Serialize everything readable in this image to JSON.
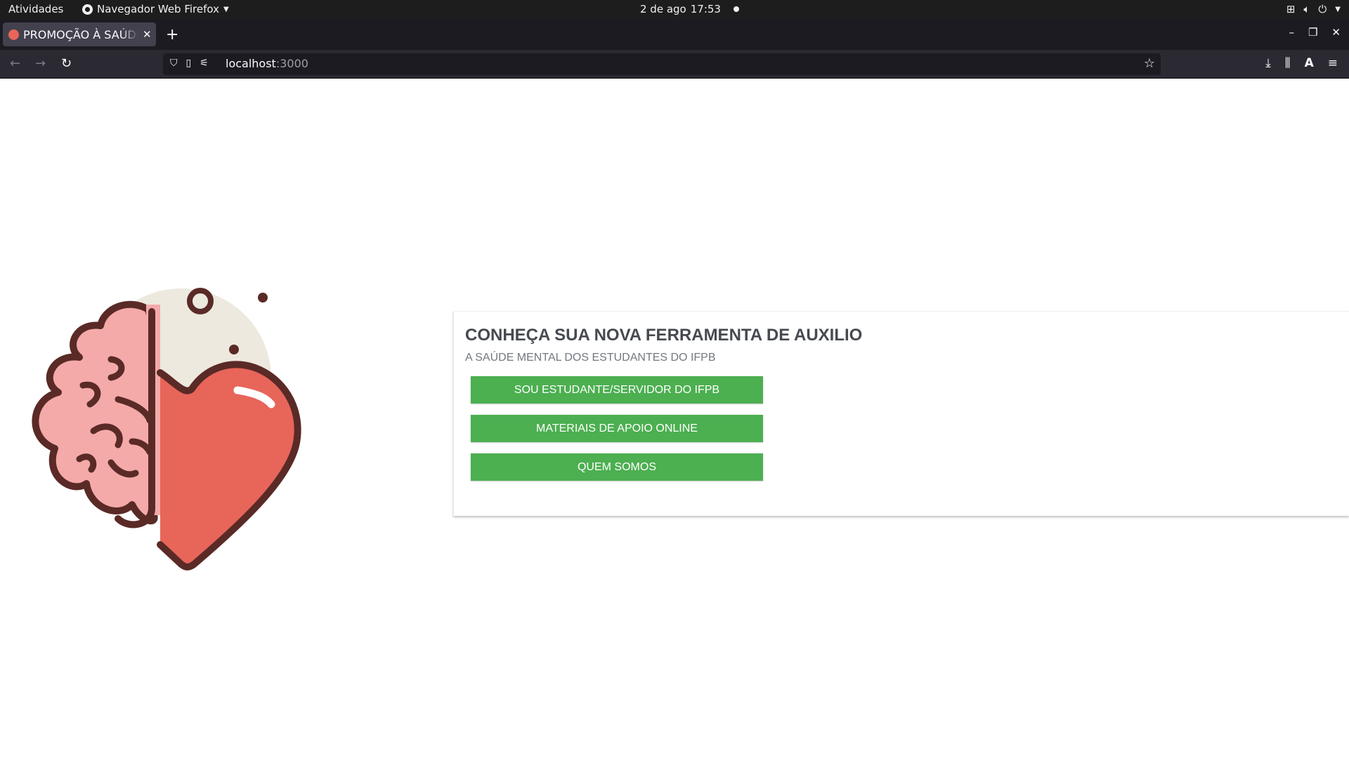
{
  "system_bar": {
    "activities": "Atividades",
    "app_name": "Navegador Web Firefox",
    "date": "2 de ago",
    "time": "17:53"
  },
  "browser": {
    "tab_title": "PROMOÇÃO À SAÚDE MENTAL",
    "url_host": "localhost",
    "url_port": ":3000"
  },
  "page": {
    "heading": "CONHEÇA SUA NOVA FERRAMENTA DE AUXILIO",
    "subtitle": "A SAÚDE MENTAL DOS ESTUDANTES DO IFPB",
    "buttons": [
      {
        "label": "SOU ESTUDANTE/SERVIDOR DO IFPB"
      },
      {
        "label": "MATERIAIS DE APOIO ONLINE"
      },
      {
        "label": "QUEM SOMOS"
      }
    ],
    "colors": {
      "button_green": "#4caf50",
      "heart_red": "#e8655a",
      "brain_pink": "#f4aaa9",
      "outline_brown": "#5a2a26",
      "backdrop_beige": "#ede9df"
    }
  }
}
